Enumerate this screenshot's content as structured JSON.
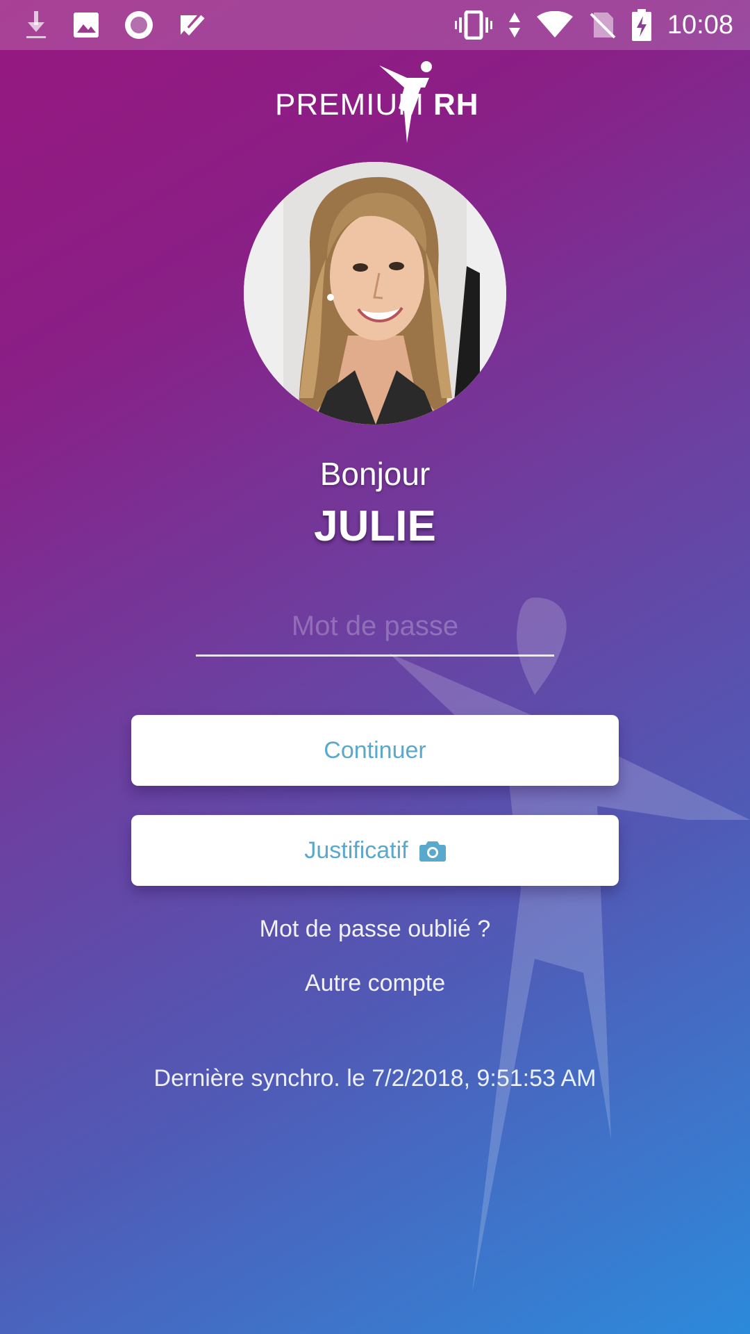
{
  "status_bar": {
    "time": "10:08",
    "left_icons": [
      "download-icon",
      "image-icon",
      "record-icon",
      "check-icon"
    ],
    "right_icons": [
      "vibrate-icon",
      "data-arrows-icon",
      "wifi-icon",
      "no-sim-icon",
      "battery-charging-icon"
    ]
  },
  "logo": {
    "text_left": "PREMIUM",
    "text_right": "RH"
  },
  "greeting": {
    "hello": "Bonjour",
    "name": "JULIE"
  },
  "password": {
    "placeholder": "Mot de passe",
    "value": ""
  },
  "buttons": {
    "continue_label": "Continuer",
    "justificatif_label": "Justificatif"
  },
  "links": {
    "forgot": "Mot de passe oublié ?",
    "other_account": "Autre compte"
  },
  "sync": {
    "text": "Dernière synchro. le 7/2/2018, 9:51:53 AM"
  },
  "colors": {
    "gradient_start": "#96187f",
    "gradient_end": "#2c8adb",
    "button_text": "#5aa8cc"
  }
}
